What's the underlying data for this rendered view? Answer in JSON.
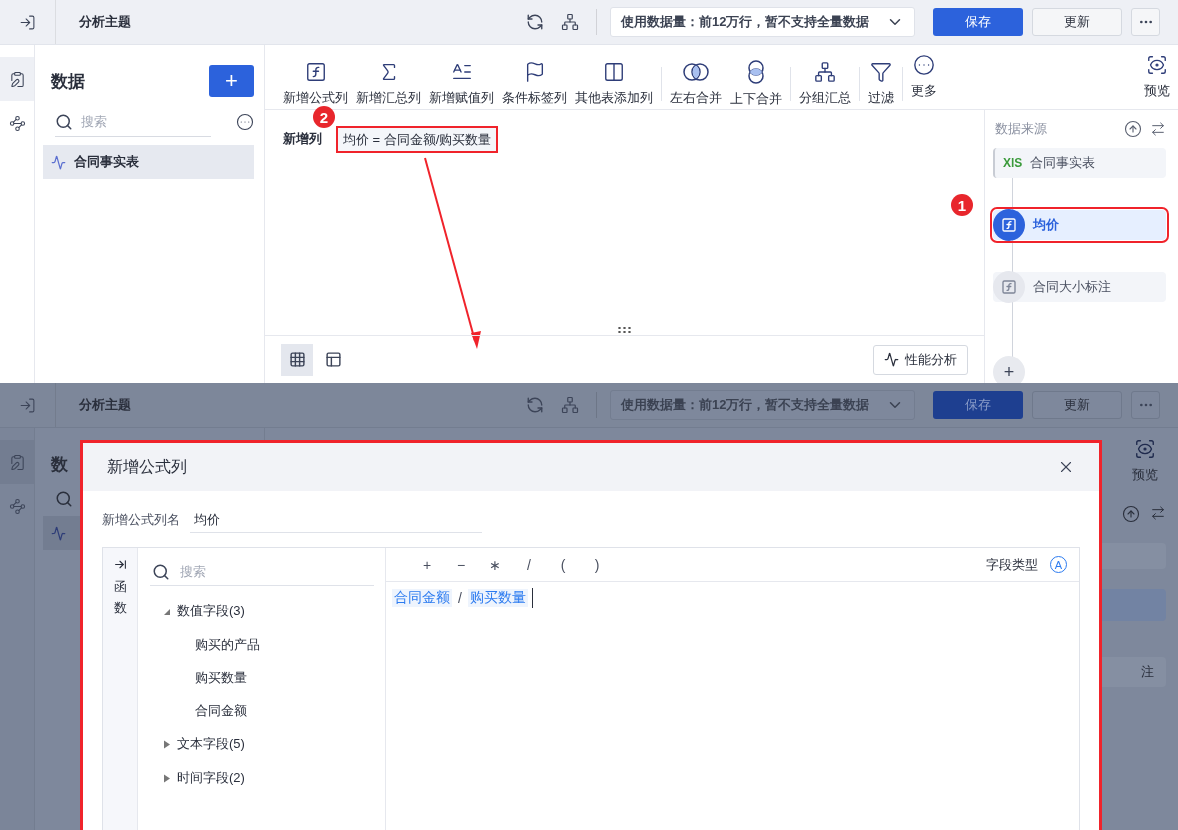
{
  "top": {
    "header": {
      "title": "分析主题",
      "data_volume": "使用数据量：前12万行，暂不支持全量数据",
      "buttons": [
        {
          "label": "保存",
          "kind": "primary"
        },
        {
          "label": "更新",
          "kind": "default"
        }
      ]
    },
    "data_panel": {
      "title": "数据",
      "add": "+",
      "search": {
        "placeholder": "搜索"
      },
      "tables": [
        {
          "name": "合同事实表",
          "selected": true
        }
      ]
    },
    "toolbar_groups": [
      {
        "items": [
          {
            "label": "新增公式列",
            "kind": "fx"
          },
          {
            "label": "新增汇总列",
            "kind": "sigma"
          },
          {
            "label": "新增赋值列",
            "kind": "assign"
          },
          {
            "label": "条件标签列",
            "kind": "flag"
          },
          {
            "label": "其他表添加列",
            "kind": "addcol"
          }
        ]
      },
      {
        "items": [
          {
            "label": "左右合并",
            "kind": "lrmerge"
          },
          {
            "label": "上下合并",
            "kind": "udmerge"
          }
        ]
      },
      {
        "items": [
          {
            "label": "分组汇总",
            "kind": "group"
          }
        ]
      },
      {
        "items": [
          {
            "label": "过滤",
            "kind": "filter"
          }
        ]
      },
      {
        "items": [
          {
            "label": "更多",
            "kind": "more"
          }
        ]
      },
      {
        "items": [
          {
            "label": "预览",
            "kind": "preview"
          }
        ]
      }
    ],
    "step": {
      "label": "新增列",
      "formula": "均价 = 合同金额/购买数量",
      "annotation": "2"
    },
    "view_toggles": [
      {
        "kind": "grid",
        "selected": true
      },
      {
        "kind": "layout",
        "selected": false
      }
    ],
    "perf_button": "性能分析",
    "source_panel": {
      "title": "数据来源",
      "steps": [
        {
          "kind": "table",
          "badge": "XlS",
          "label": "合同事实表",
          "selected": false
        },
        {
          "kind": "formula",
          "label": "均价",
          "selected": true,
          "annotation": "1"
        },
        {
          "kind": "formula",
          "label": "合同大小标注",
          "selected": false
        }
      ],
      "add": "+"
    }
  },
  "bottom": {
    "background": {
      "title": "分析主题",
      "data_volume": "使用数据量：前12万行，暂不支持全量数据",
      "buttons": [
        {
          "label": "保存",
          "kind": "primary"
        },
        {
          "label": "更新",
          "kind": "default"
        }
      ],
      "data_title": "数",
      "preview": "预览",
      "step_fragment": "注"
    },
    "dialog": {
      "title": "新增公式列",
      "name_label": "新增公式列名",
      "name_value": "均价",
      "function_tab": "函数",
      "search": {
        "placeholder": "搜索"
      },
      "field_groups": [
        {
          "label": "数值字段(3)",
          "expanded": true,
          "children": [
            {
              "label": "购买的产品"
            },
            {
              "label": "购买数量"
            },
            {
              "label": "合同金额"
            }
          ]
        },
        {
          "label": "文本字段(5)",
          "expanded": false
        },
        {
          "label": "时间字段(2)",
          "expanded": false
        }
      ],
      "operators": [
        "+",
        "−",
        "∗",
        "/",
        "(",
        ")"
      ],
      "field_type_label": "字段类型",
      "field_type_icon": "A",
      "formula_tokens": [
        {
          "kind": "field",
          "text": "合同金额"
        },
        {
          "kind": "operator",
          "text": "/"
        },
        {
          "kind": "field",
          "text": "购买数量"
        }
      ]
    }
  }
}
